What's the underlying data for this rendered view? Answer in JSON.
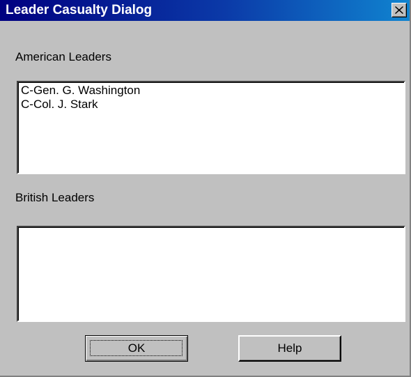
{
  "window": {
    "title": "Leader Casualty Dialog",
    "close_glyph": "✕"
  },
  "american": {
    "label": "American Leaders",
    "items": [
      "C-Gen. G. Washington",
      "C-Col. J. Stark"
    ]
  },
  "british": {
    "label": "British Leaders",
    "items": []
  },
  "buttons": {
    "ok_label": "OK",
    "help_label": "Help"
  }
}
